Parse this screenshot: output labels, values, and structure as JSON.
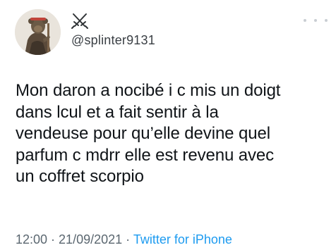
{
  "user": {
    "display_name_icon": "crossed-swords-icon",
    "handle": "@splinter9131"
  },
  "tweet": {
    "text": "Mon daron a nocibé i c mis un doigt\ndans lcul et a fait sentir à la\nvendeuse pour qu’elle devine quel\nparfum c mdrr elle est revenu avec\nun coffret scorpio",
    "time": "12:00",
    "separator": " · ",
    "date": "21/09/2021",
    "source": "Twitter for iPhone"
  },
  "colors": {
    "link": "#1d9bf0",
    "meta": "#5b6770",
    "text": "#101418"
  },
  "icons": {
    "more": "more-dots-icon"
  }
}
